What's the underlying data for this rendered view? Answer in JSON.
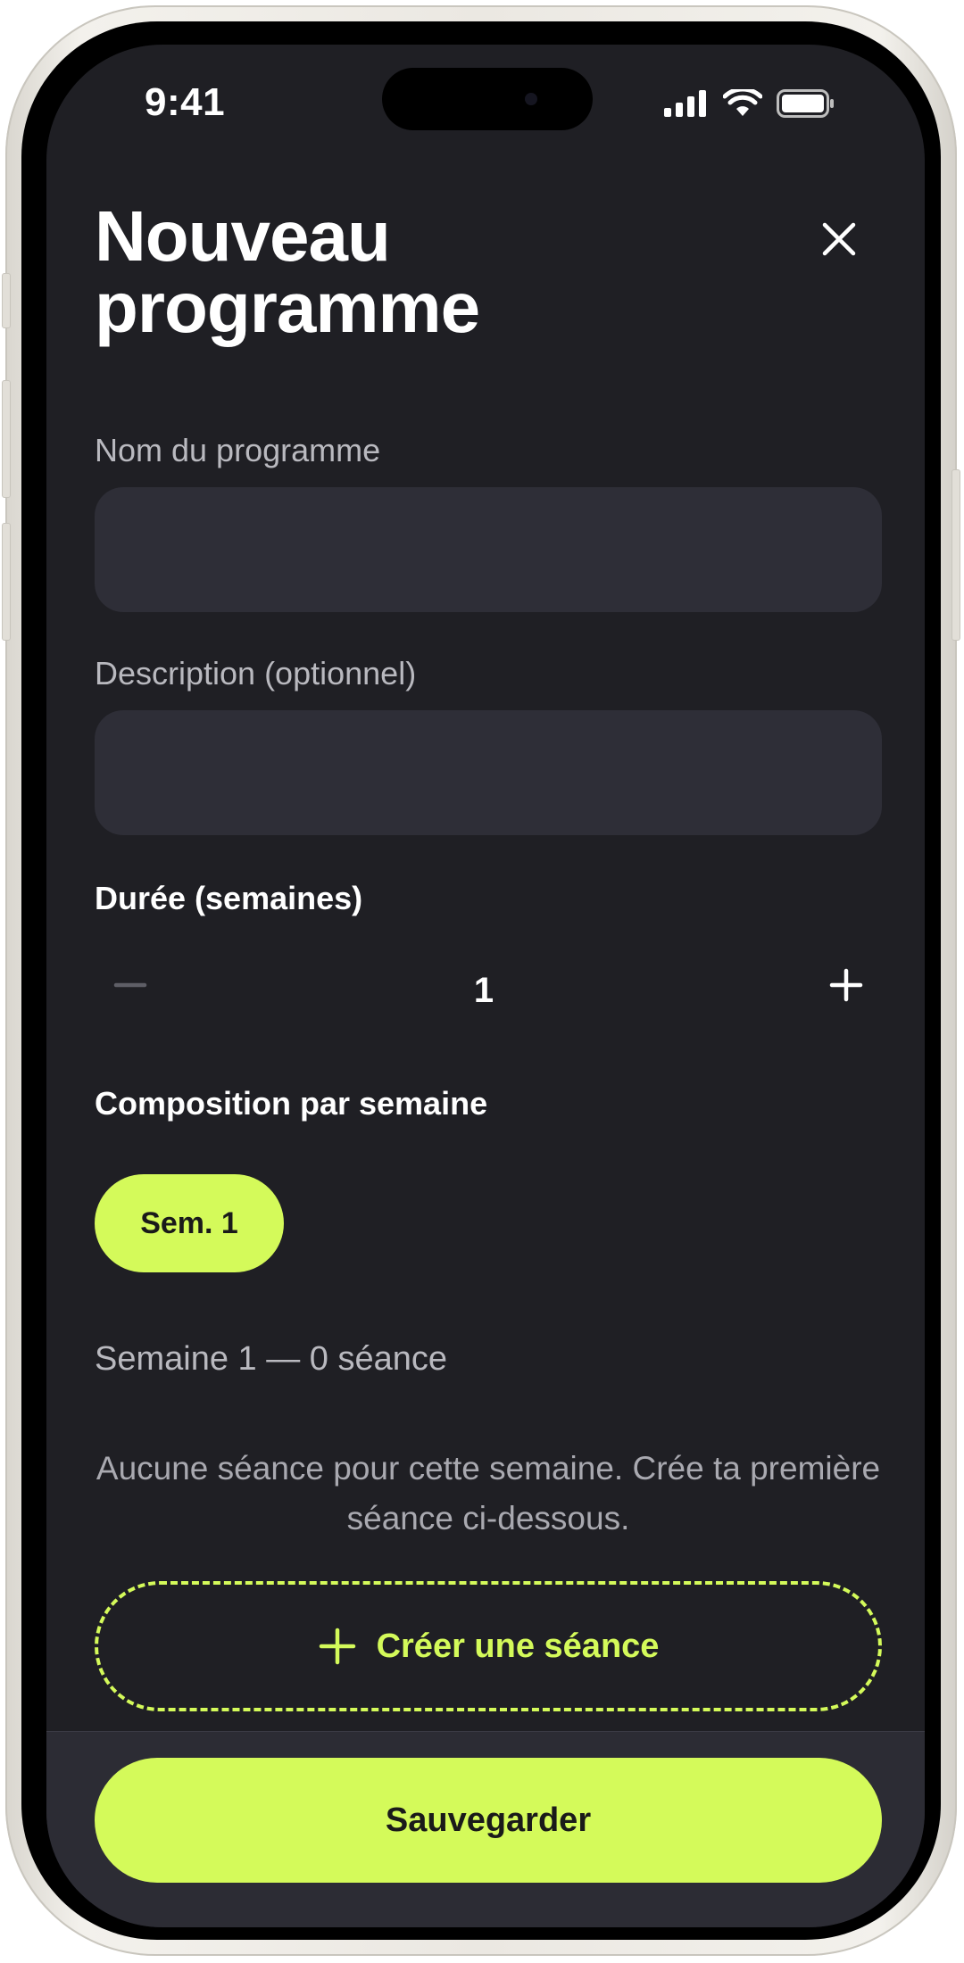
{
  "status_bar": {
    "time": "9:41"
  },
  "header": {
    "title": "Nouveau programme",
    "close_icon": "close-icon"
  },
  "form": {
    "name_label": "Nom du programme",
    "name_value": "",
    "description_label": "Description (optionnel)",
    "description_value": "",
    "duration_label": "Durée (semaines)",
    "duration_value": "1"
  },
  "composition": {
    "label": "Composition par semaine",
    "weeks": [
      {
        "label": "Sem. 1",
        "selected": true
      }
    ],
    "week_summary": "Semaine 1 — 0 séance",
    "empty_message": "Aucune séance pour cette semaine. Crée ta première séance ci-dessous.",
    "create_label": "Créer une séance"
  },
  "footer": {
    "save_label": "Sauvegarder"
  },
  "colors": {
    "background": "#1f1f24",
    "surface": "#2e2e37",
    "accent": "#d4fa5a",
    "text_primary": "#ffffff",
    "text_secondary": "#b9b9bf"
  }
}
